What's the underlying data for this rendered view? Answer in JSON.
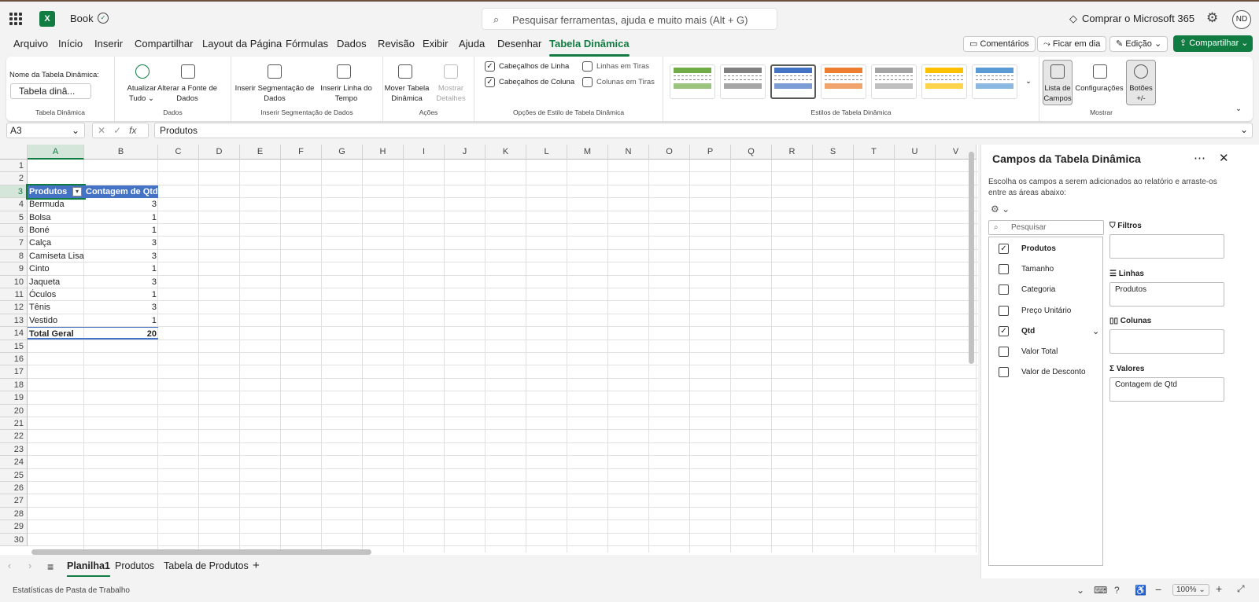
{
  "app": {
    "book_title": "Book",
    "search_placeholder": "Pesquisar ferramentas, ajuda e muito mais (Alt + G)",
    "buy_label": "Comprar o Microsoft 365",
    "avatar_initials": "ND"
  },
  "menu_tabs": [
    "Arquivo",
    "Início",
    "Inserir",
    "Compartilhar",
    "Layout da Página",
    "Fórmulas",
    "Dados",
    "Revisão",
    "Exibir",
    "Ajuda",
    "Desenhar",
    "Tabela Dinâmica"
  ],
  "active_tab": "Tabela Dinâmica",
  "right_buttons": {
    "comments": "Comentários",
    "catch_up": "Ficar em dia",
    "editing": "Edição",
    "share": "Compartilhar"
  },
  "ribbon": {
    "pivot_name_label": "Nome da Tabela Dinâmica:",
    "pivot_name_value": "Tabela dinâ...",
    "group_pivot": "Tabela Dinâmica",
    "refresh": "Atualizar",
    "refresh2": "Tudo",
    "change_source": "Alterar a Fonte de",
    "change_source2": "Dados",
    "group_data": "Dados",
    "insert_slicer": "Inserir Segmentação de",
    "insert_slicer2": "Dados",
    "insert_timeline": "Inserir Linha do",
    "insert_timeline2": "Tempo",
    "group_slicer": "Inserir Segmentação de Dados",
    "move_pivot": "Mover Tabela",
    "move_pivot2": "Dinâmica",
    "show_details": "Mostrar",
    "show_details2": "Detalhes",
    "group_actions": "Ações",
    "row_headers": "Cabeçalhos de Linha",
    "col_headers": "Cabeçalhos de Coluna",
    "banded_rows": "Linhas em Tiras",
    "banded_cols": "Colunas em Tiras",
    "group_style_options": "Opções de Estilo de Tabela Dinâmica",
    "group_styles": "Estilos de Tabela Dinâmica",
    "style_colors": [
      "#70ad47",
      "#808080",
      "#4472c4",
      "#ed7d31",
      "#a5a5a5",
      "#ffc000",
      "#5b9bd5"
    ],
    "field_list": "Lista de",
    "field_list2": "Campos",
    "settings": "Configurações",
    "buttons": "Botões",
    "buttons2": "+/-",
    "group_show": "Mostrar"
  },
  "formula_bar": {
    "name_box": "A3",
    "fx": "fx",
    "content": "Produtos"
  },
  "columns": [
    "A",
    "B",
    "C",
    "D",
    "E",
    "F",
    "G",
    "H",
    "I",
    "J",
    "K",
    "L",
    "M",
    "N",
    "O",
    "P",
    "Q",
    "R",
    "S",
    "T",
    "U",
    "V"
  ],
  "rows": [
    "1",
    "2",
    "3",
    "4",
    "5",
    "6",
    "7",
    "8",
    "9",
    "10",
    "11",
    "12",
    "13",
    "14",
    "15",
    "16",
    "17",
    "18",
    "19",
    "20",
    "21",
    "22",
    "23",
    "24",
    "25",
    "26",
    "27",
    "28",
    "29",
    "30"
  ],
  "pivot": {
    "header_a": "Produtos",
    "header_b": "Contagem de Qtd",
    "items": [
      {
        "name": "Bermuda",
        "count": "3"
      },
      {
        "name": "Bolsa",
        "count": "1"
      },
      {
        "name": "Boné",
        "count": "1"
      },
      {
        "name": "Calça",
        "count": "3"
      },
      {
        "name": "Camiseta Lisa",
        "count": "3"
      },
      {
        "name": "Cinto",
        "count": "1"
      },
      {
        "name": "Jaqueta",
        "count": "3"
      },
      {
        "name": "Óculos",
        "count": "1"
      },
      {
        "name": "Tênis",
        "count": "3"
      },
      {
        "name": "Vestido",
        "count": "1"
      }
    ],
    "total_label": "Total Geral",
    "total_value": "20"
  },
  "sheet_tabs": [
    "Planilha1",
    "Produtos",
    "Tabela de Produtos"
  ],
  "active_sheet": "Planilha1",
  "status": {
    "left": "Estatísticas de Pasta de Trabalho",
    "zoom": "100%"
  },
  "panel": {
    "title": "Campos da Tabela Dinâmica",
    "description": "Escolha os campos a serem adicionados ao relatório e arraste-os entre as áreas abaixo:",
    "search_placeholder": "Pesquisar",
    "fields": [
      {
        "name": "Produtos",
        "checked": true
      },
      {
        "name": "Tamanho",
        "checked": false
      },
      {
        "name": "Categoria",
        "checked": false
      },
      {
        "name": "Preço Unitário",
        "checked": false
      },
      {
        "name": "Qtd",
        "checked": true
      },
      {
        "name": "Valor Total",
        "checked": false
      },
      {
        "name": "Valor de Desconto",
        "checked": false
      }
    ],
    "filters_label": "Filtros",
    "rows_label": "Linhas",
    "rows_value": "Produtos",
    "columns_label": "Colunas",
    "values_label": "Valores",
    "values_value": "Contagem de Qtd"
  }
}
